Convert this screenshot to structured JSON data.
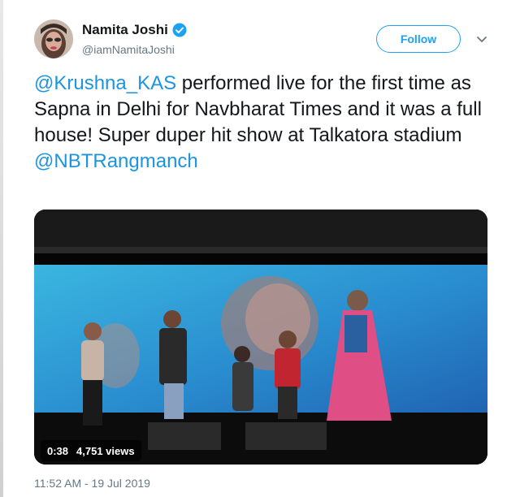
{
  "tweet": {
    "user": {
      "name": "Namita Joshi",
      "handle": "@iamNamitaJoshi",
      "verified": true
    },
    "follow_label": "Follow",
    "text_segments": [
      {
        "text": "@Krushna_KAS",
        "type": "mention"
      },
      {
        "text": " performed live for the first time as Sapna in Delhi for Navbharat Times and it was a full house! Super duper hit show at Talkatora stadium ",
        "type": "text"
      },
      {
        "text": "@NBTRangmanch",
        "type": "mention"
      }
    ],
    "media": {
      "duration": "0:38",
      "views": "4,751 views"
    },
    "timestamp": "11:52 AM - 19 Jul 2019"
  },
  "colors": {
    "accent": "#1da1f2",
    "mention": "#1b95e0",
    "text": "#14171a",
    "secondary": "#657786"
  },
  "icons": [
    "verified-icon",
    "chevron-down-icon",
    "avatar"
  ]
}
